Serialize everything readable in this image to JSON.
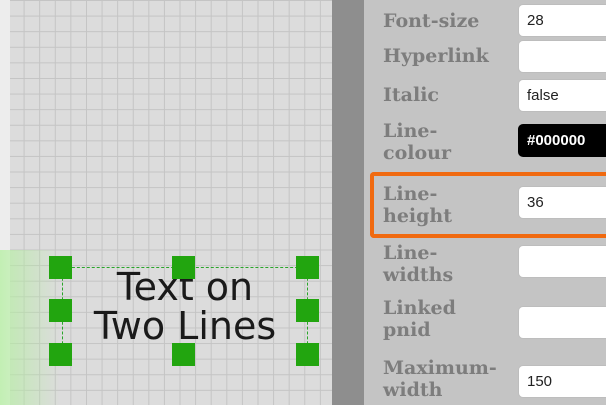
{
  "canvas": {
    "text_object": {
      "lines": [
        "Text on",
        "Two Lines"
      ]
    }
  },
  "properties": [
    {
      "label": [
        "Font-size"
      ],
      "value": "28"
    },
    {
      "label": [
        "Hyperlink"
      ],
      "value": ""
    },
    {
      "label": [
        "Italic"
      ],
      "value": "false"
    },
    {
      "label": [
        "Line-",
        "colour"
      ],
      "value": "#000000"
    },
    {
      "label": [
        "Line-",
        "height"
      ],
      "value": "36"
    },
    {
      "label": [
        "Line-",
        "widths"
      ],
      "value": ""
    },
    {
      "label": [
        "Linked",
        "pnid"
      ],
      "value": ""
    },
    {
      "label": [
        "Maximum-",
        "width"
      ],
      "value": "150"
    }
  ],
  "colors": {
    "highlight": "#f06a10",
    "handle": "#22a50f",
    "line_colour_swatch": "#000000"
  },
  "icons": {
    "handle": "resize-handle"
  }
}
